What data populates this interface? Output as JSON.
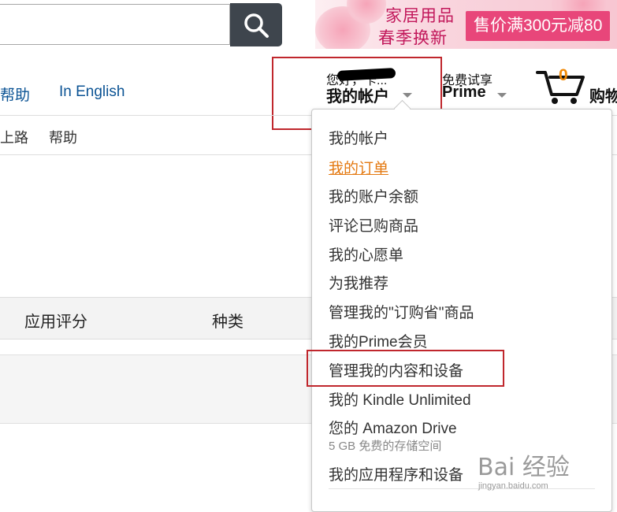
{
  "search": {
    "value": "",
    "placeholder": "",
    "button_icon": "search-icon"
  },
  "banner": {
    "line1": "家居用品",
    "line2": "春季换新",
    "promo": "售价满300元减80"
  },
  "nav": {
    "help": "帮助",
    "english": "In English",
    "account_greeting": "您好，卡...",
    "account_label": "我的帐户",
    "prime_top": "免费试享",
    "prime_label": "Prime",
    "cart_count": "0",
    "cart_label": "购物"
  },
  "subnav": {
    "item1": "上路",
    "item2": "帮助"
  },
  "table": {
    "col_rating": "应用评分",
    "col_category": "种类"
  },
  "dropdown": {
    "items": [
      "我的帐户",
      "我的订单",
      "我的账户余额",
      "评论已购商品",
      "我的心愿单",
      "为我推荐",
      "管理我的\"订购省\"商品",
      "我的Prime会员",
      "管理我的内容和设备",
      "我的 Kindle Unlimited",
      "您的 Amazon Drive",
      "我的应用程序和设备"
    ],
    "drive_sub": "5 GB 免费的存储空间",
    "active_index": 1
  },
  "watermark": {
    "text": "Bai 经验",
    "sub": "jingyan.baidu.com"
  },
  "colors": {
    "link": "#0b5394",
    "accent": "#e47911",
    "highlight": "#c0272d",
    "cart": "#f08804",
    "search_button": "#3e454d"
  }
}
